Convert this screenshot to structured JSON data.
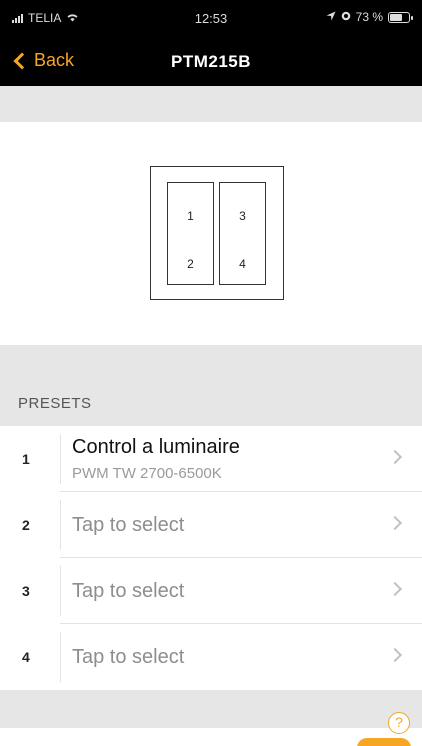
{
  "status_bar": {
    "carrier": "TELIA",
    "time": "12:53",
    "battery": "73 %",
    "battery_level": 0.73
  },
  "nav": {
    "back_label": "Back",
    "title": "PTM215B"
  },
  "switch_diagram": {
    "buttons": [
      "1",
      "2",
      "3",
      "4"
    ]
  },
  "presets": {
    "section_label": "PRESETS",
    "items": [
      {
        "number": "1",
        "title": "Control a luminaire",
        "subtitle": "PWM TW 2700-6500K"
      },
      {
        "number": "2",
        "placeholder": "Tap to select"
      },
      {
        "number": "3",
        "placeholder": "Tap to select"
      },
      {
        "number": "4",
        "placeholder": "Tap to select"
      }
    ]
  },
  "help": {
    "symbol": "?"
  },
  "colors": {
    "accent": "#f5a623",
    "nav_bg": "#000000",
    "section_bg": "#e6e6e6"
  }
}
